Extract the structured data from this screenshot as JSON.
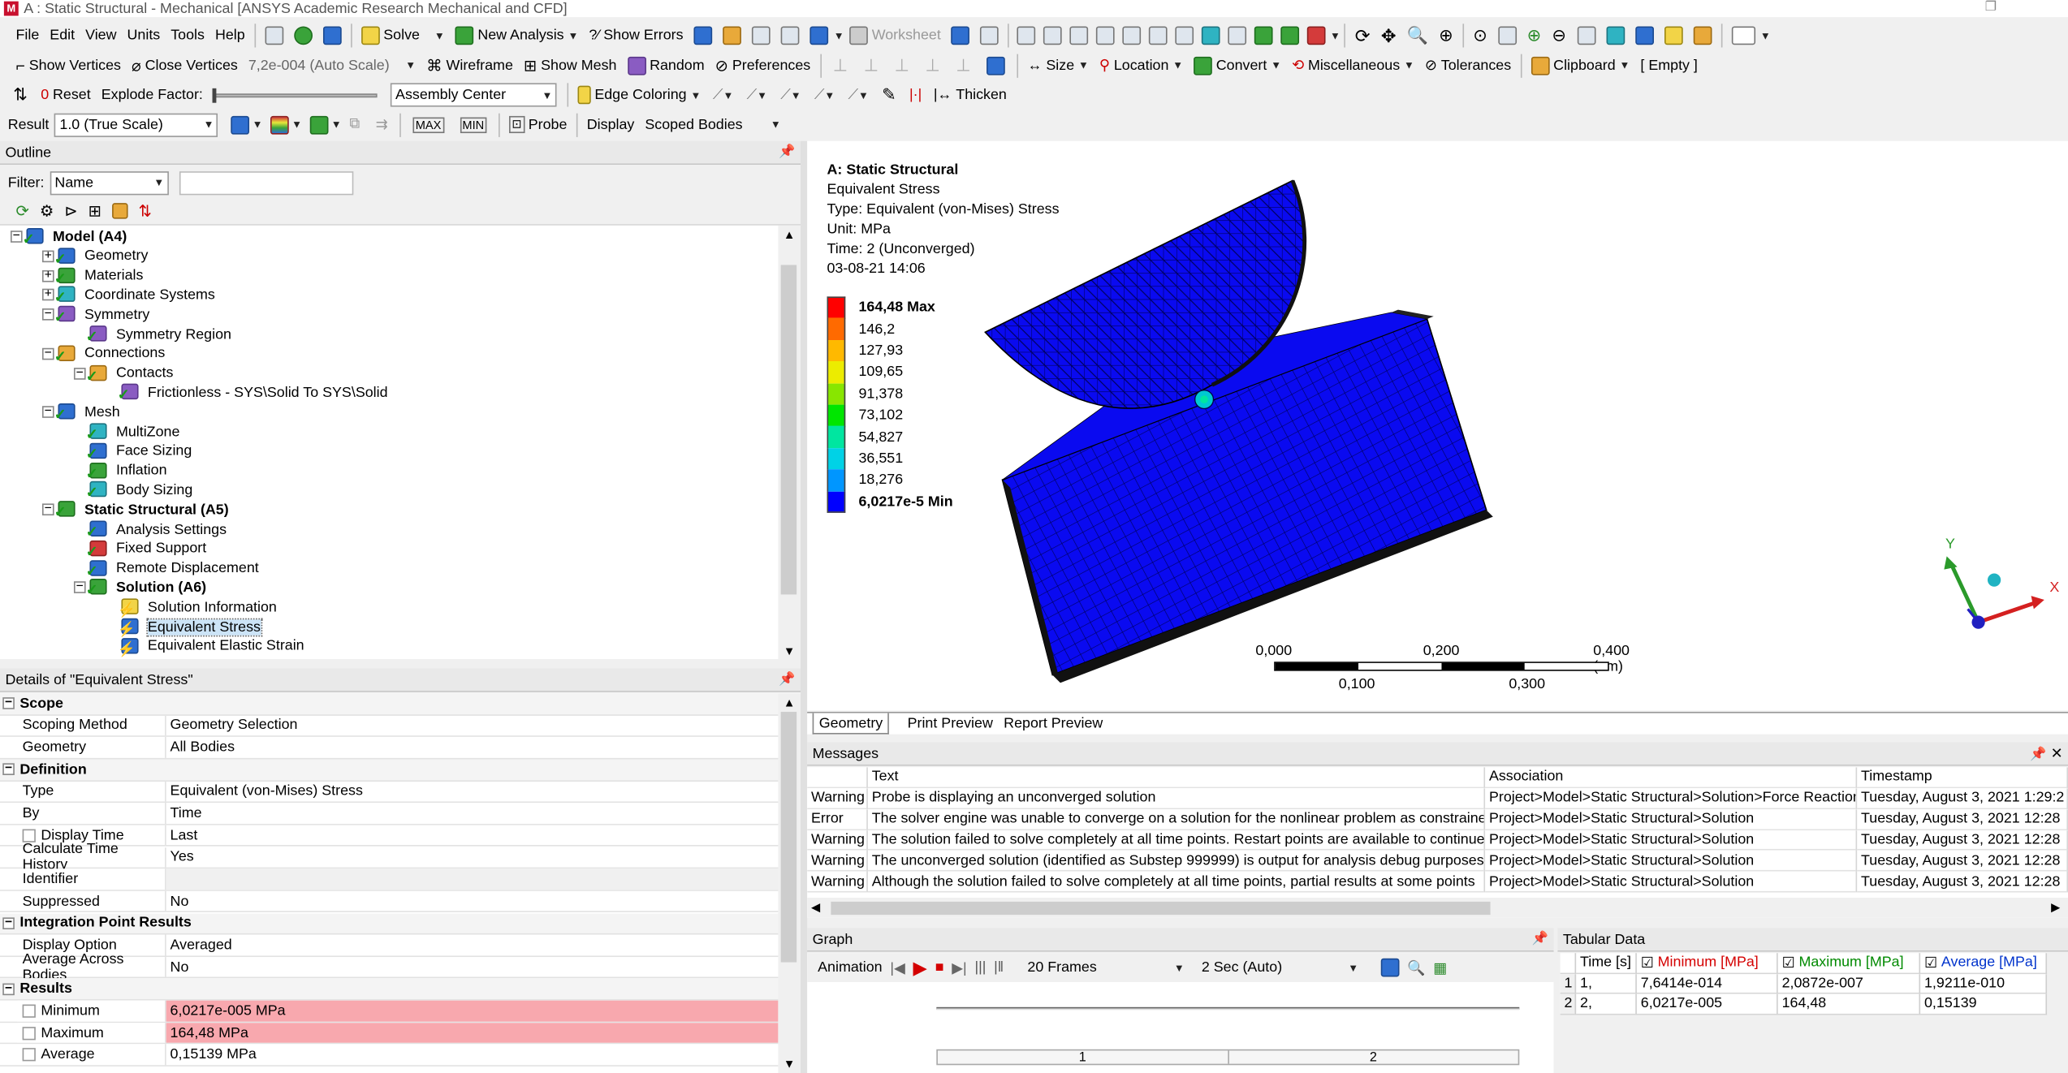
{
  "window": {
    "title": "A : Static Structural - Mechanical [ANSYS Academic Research Mechanical and CFD]"
  },
  "menu": [
    "File",
    "Edit",
    "View",
    "Units",
    "Tools",
    "Help"
  ],
  "toolbar1": {
    "solve": "Solve",
    "new_analysis": "New Analysis",
    "show_errors": "?⁄ Show Errors",
    "worksheet": "Worksheet"
  },
  "toolbar2": {
    "show_vertices": "Show Vertices",
    "close_vertices": "Close Vertices",
    "scale": "7,2e-004 (Auto Scale)",
    "wireframe": "Wireframe",
    "show_mesh": "Show Mesh",
    "random": "Random",
    "preferences": "Preferences",
    "size": "Size",
    "location": "Location",
    "convert": "Convert",
    "miscellaneous": "Miscellaneous",
    "tolerances": "Tolerances",
    "clipboard": "Clipboard",
    "empty": "[ Empty ]"
  },
  "toolbar3": {
    "reset": "Reset",
    "explode_factor": "Explode Factor:",
    "assembly_center": "Assembly Center",
    "edge_coloring": "Edge Coloring",
    "thicken": "Thicken"
  },
  "toolbar4": {
    "result": "Result",
    "result_scale": "1.0 (True Scale)",
    "probe": "Probe",
    "display": "Display",
    "display_value": "Scoped Bodies"
  },
  "outline": {
    "title": "Outline",
    "filter_label": "Filter:",
    "filter_value": "Name",
    "filter_text": "",
    "items": [
      {
        "label": "Model (A4)",
        "level": 0,
        "bold": true,
        "exp": "−"
      },
      {
        "label": "Geometry",
        "level": 1,
        "exp": "+"
      },
      {
        "label": "Materials",
        "level": 1,
        "exp": "+"
      },
      {
        "label": "Coordinate Systems",
        "level": 1,
        "exp": "+"
      },
      {
        "label": "Symmetry",
        "level": 1,
        "exp": "−"
      },
      {
        "label": "Symmetry Region",
        "level": 2,
        "exp": ""
      },
      {
        "label": "Connections",
        "level": 1,
        "exp": "−"
      },
      {
        "label": "Contacts",
        "level": 2,
        "exp": "−"
      },
      {
        "label": "Frictionless - SYS\\Solid To SYS\\Solid",
        "level": 3,
        "exp": ""
      },
      {
        "label": "Mesh",
        "level": 1,
        "exp": "−"
      },
      {
        "label": "MultiZone",
        "level": 2,
        "exp": ""
      },
      {
        "label": "Face Sizing",
        "level": 2,
        "exp": ""
      },
      {
        "label": "Inflation",
        "level": 2,
        "exp": ""
      },
      {
        "label": "Body Sizing",
        "level": 2,
        "exp": ""
      },
      {
        "label": "Static Structural (A5)",
        "level": 1,
        "bold": true,
        "exp": "−"
      },
      {
        "label": "Analysis Settings",
        "level": 2,
        "exp": ""
      },
      {
        "label": "Fixed Support",
        "level": 2,
        "exp": ""
      },
      {
        "label": "Remote Displacement",
        "level": 2,
        "exp": ""
      },
      {
        "label": "Solution (A6)",
        "level": 2,
        "bold": true,
        "exp": "−"
      },
      {
        "label": "Solution Information",
        "level": 3,
        "exp": ""
      },
      {
        "label": "Equivalent Stress",
        "level": 3,
        "exp": "",
        "selected": true
      },
      {
        "label": "Equivalent Elastic Strain",
        "level": 3,
        "exp": ""
      }
    ]
  },
  "details": {
    "title": "Details of \"Equivalent Stress\"",
    "rows": [
      {
        "section": "Scope"
      },
      {
        "k": "Scoping Method",
        "v": "Geometry Selection"
      },
      {
        "k": "Geometry",
        "v": "All Bodies"
      },
      {
        "section": "Definition"
      },
      {
        "k": "Type",
        "v": "Equivalent (von-Mises) Stress"
      },
      {
        "k": "By",
        "v": "Time"
      },
      {
        "k": "Display Time",
        "v": "Last",
        "cb": true
      },
      {
        "k": "Calculate Time History",
        "v": "Yes"
      },
      {
        "k": "Identifier",
        "v": ""
      },
      {
        "k": "Suppressed",
        "v": "No"
      },
      {
        "section": "Integration Point Results"
      },
      {
        "k": "Display Option",
        "v": "Averaged"
      },
      {
        "k": "Average Across Bodies",
        "v": "No"
      },
      {
        "section": "Results"
      },
      {
        "k": "Minimum",
        "v": "6,0217e-005 MPa",
        "cb": true,
        "hl": true
      },
      {
        "k": "Maximum",
        "v": "164,48 MPa",
        "cb": true,
        "hl": true
      },
      {
        "k": "Average",
        "v": "0,15139 MPa",
        "cb": true
      }
    ]
  },
  "viewport": {
    "annotation": [
      "A: Static Structural",
      "Equivalent Stress",
      "Type: Equivalent (von-Mises) Stress",
      "Unit: MPa",
      "Time: 2 (Unconverged)",
      "03-08-21 14:06"
    ],
    "legend": [
      {
        "label": "164,48 Max",
        "color": "#ff0000",
        "bold": true
      },
      {
        "label": "146,2",
        "color": "#ff6a00"
      },
      {
        "label": "127,93",
        "color": "#ffb900"
      },
      {
        "label": "109,65",
        "color": "#ecec00"
      },
      {
        "label": "91,378",
        "color": "#88e600"
      },
      {
        "label": "73,102",
        "color": "#00e600"
      },
      {
        "label": "54,827",
        "color": "#00e6a0"
      },
      {
        "label": "36,551",
        "color": "#00d2e6"
      },
      {
        "label": "18,276",
        "color": "#0096ff"
      },
      {
        "label": "6,0217e-5 Min",
        "color": "#0000ff",
        "bold": true
      }
    ],
    "scale_top": [
      "0,000",
      "0,200",
      "0,400 (um)"
    ],
    "scale_bottom": [
      "0,100",
      "0,300"
    ],
    "axis": {
      "x": "X",
      "y": "Y"
    },
    "tabs": [
      "Geometry",
      "Print Preview",
      "Report Preview"
    ]
  },
  "messages": {
    "title": "Messages",
    "columns": [
      "",
      "Text",
      "Association",
      "Timestamp"
    ],
    "rows": [
      [
        "Warning",
        "Probe is displaying an unconverged solution",
        "Project>Model>Static Structural>Solution>Force Reaction",
        "Tuesday, August 3, 2021 1:29:2"
      ],
      [
        "Error",
        "The solver engine was unable to converge on a solution for the nonlinear problem as constrained.",
        "Project>Model>Static Structural>Solution",
        "Tuesday, August 3, 2021 12:28"
      ],
      [
        "Warning",
        "The solution failed to solve completely at all time points. Restart points are available to continue",
        "Project>Model>Static Structural>Solution",
        "Tuesday, August 3, 2021 12:28"
      ],
      [
        "Warning",
        "The unconverged solution (identified as Substep 999999) is output for analysis debug purposes.",
        "Project>Model>Static Structural>Solution",
        "Tuesday, August 3, 2021 12:28"
      ],
      [
        "Warning",
        "Although the solution failed to solve completely at all time points, partial results at some points",
        "Project>Model>Static Structural>Solution",
        "Tuesday, August 3, 2021 12:28"
      ]
    ]
  },
  "graph": {
    "title": "Graph",
    "animation": "Animation",
    "frames": "20 Frames",
    "duration": "2 Sec (Auto)",
    "ticks": [
      "1",
      "2"
    ]
  },
  "tabular": {
    "title": "Tabular Data",
    "columns": [
      "",
      "Time [s]",
      "Minimum [MPa]",
      "Maximum [MPa]",
      "Average [MPa]"
    ],
    "column_colors": [
      "#000000",
      "#000000",
      "#d40000",
      "#008a00",
      "#0033cc"
    ],
    "rows": [
      [
        "1",
        "1,",
        "7,6414e-014",
        "2,0872e-007",
        "1,9211e-010"
      ],
      [
        "2",
        "2,",
        "6,0217e-005",
        "164,48",
        "0,15139"
      ]
    ]
  }
}
